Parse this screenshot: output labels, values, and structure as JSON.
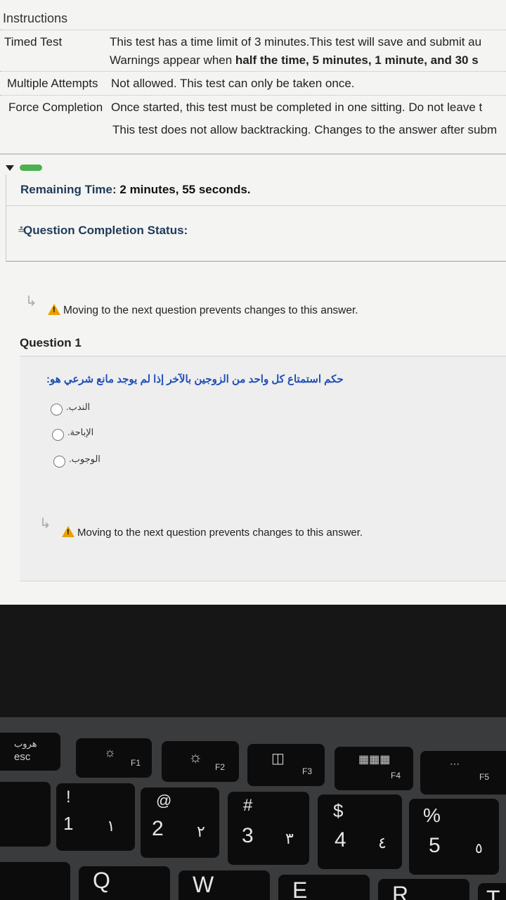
{
  "instructions": {
    "heading": "Instructions",
    "rows": [
      {
        "label": "Timed Test",
        "line1": "This test has a time limit of 3 minutes.This test will save and submit au",
        "line2_pre": "Warnings appear when ",
        "line2_bold": "half the time, 5 minutes, 1 minute, and 30 s"
      },
      {
        "label": "Multiple Attempts",
        "value": "Not allowed. This test can only be taken once."
      },
      {
        "label": "Force Completion",
        "value": "Once started, this test must be completed in one sitting. Do not leave t"
      }
    ],
    "backtrack": "This test does not allow backtracking. Changes to the answer after subm"
  },
  "status": {
    "remaining_label": "Remaining Time:",
    "remaining_value": "2 minutes, 55 seconds.",
    "completion_label": "Question Completion Status:"
  },
  "warning_text": "Moving to the next question prevents changes to this answer.",
  "question": {
    "title": "Question 1",
    "text": "حكم استمتاع كل واحد من الزوجين بالآخر إذا لم يوجد مانع شرعي هو:",
    "options": [
      "الندب.",
      "الإباحة.",
      "الوجوب."
    ]
  },
  "keyboard": {
    "esc_arabic": "هروب",
    "esc": "esc",
    "f1": "F1",
    "f2": "F2",
    "f3": "F3",
    "f4": "F4",
    "f5": "F5",
    "num1_top": "!",
    "num1": "1",
    "num1_ar": "١",
    "num2_top": "@",
    "num2": "2",
    "num2_ar": "٢",
    "num3_top": "#",
    "num3": "3",
    "num3_ar": "٣",
    "num4_top": "$",
    "num4": "4",
    "num4_ar": "٤",
    "num5_top": "%",
    "num5": "5",
    "num5_ar": "٥",
    "q": "Q",
    "w": "W",
    "e": "E",
    "r": "R",
    "t": "T"
  }
}
